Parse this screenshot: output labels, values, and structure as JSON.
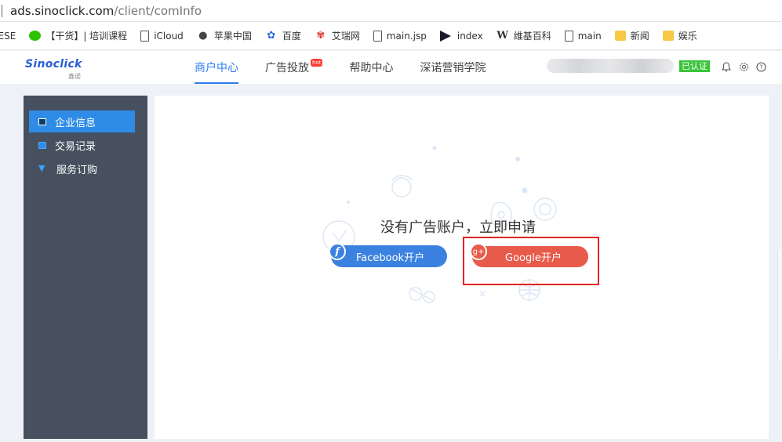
{
  "browser": {
    "url_domain": "ads.sinoclick.com",
    "url_path": "/client/comInfo"
  },
  "bookmarks": [
    {
      "label": "IESE",
      "icon": "none"
    },
    {
      "label": "【干货】| 培训课程",
      "icon": "wechat-icon"
    },
    {
      "label": "iCloud",
      "icon": "page-icon"
    },
    {
      "label": "苹果中国",
      "icon": "apple-icon"
    },
    {
      "label": "百度",
      "icon": "paw-icon"
    },
    {
      "label": "艾瑞网",
      "icon": "flag-icon"
    },
    {
      "label": "main.jsp",
      "icon": "page-icon"
    },
    {
      "label": "index",
      "icon": "play-icon"
    },
    {
      "label": "维基百科",
      "icon": "w-icon"
    },
    {
      "label": "main",
      "icon": "page-icon"
    },
    {
      "label": "新闻",
      "icon": "folder-icon"
    },
    {
      "label": "娱乐",
      "icon": "folder-icon"
    }
  ],
  "header": {
    "logo_text": "Sinoclick",
    "logo_sub": "鑫诺",
    "nav": [
      {
        "label": "商户中心",
        "active": true
      },
      {
        "label": "广告投放",
        "badge": "hot"
      },
      {
        "label": "帮助中心"
      },
      {
        "label": "深诺营销学院"
      }
    ],
    "verified_label": "已认证"
  },
  "sidebar": {
    "items": [
      {
        "label": "企业信息",
        "active": true,
        "icon": "building-icon"
      },
      {
        "label": "交易记录",
        "icon": "note-icon"
      },
      {
        "label": "服务订购",
        "icon": "cart-icon"
      }
    ]
  },
  "main": {
    "headline": "没有广告账户，立即申请",
    "facebook_button": "Facebook开户",
    "google_button": "Google开户",
    "facebook_icon_text": "f",
    "google_icon_text": "g+"
  },
  "colors": {
    "accent": "#2b7cf0",
    "sidebar_bg": "#46505f",
    "facebook": "#3b82e0",
    "google": "#e85a4a",
    "highlight": "#e52222",
    "verified": "#3ac43a"
  }
}
